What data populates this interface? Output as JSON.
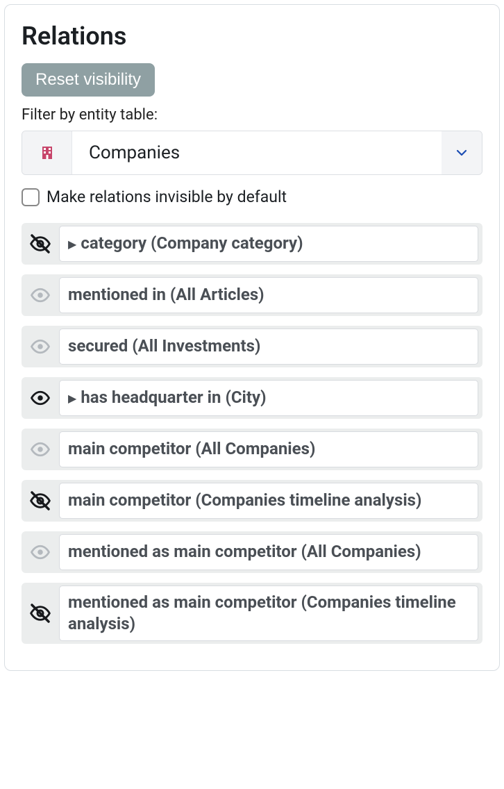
{
  "title": "Relations",
  "reset_button": "Reset visibility",
  "filter_label": "Filter by entity table:",
  "dropdown": {
    "selected": "Companies"
  },
  "checkbox_label": "Make relations invisible by default",
  "relations": [
    {
      "label": "category (Company category)",
      "state": "hidden",
      "expandable": true
    },
    {
      "label": "mentioned in (All Articles)",
      "state": "dim",
      "expandable": false
    },
    {
      "label": "secured (All Investments)",
      "state": "dim",
      "expandable": false
    },
    {
      "label": "has headquarter in (City)",
      "state": "visible",
      "expandable": true
    },
    {
      "label": "main competitor (All Companies)",
      "state": "dim",
      "expandable": false
    },
    {
      "label": "main competitor (Companies timeline analysis)",
      "state": "hidden",
      "expandable": false
    },
    {
      "label": "mentioned as main competitor (All Companies)",
      "state": "dim",
      "expandable": false
    },
    {
      "label": "mentioned as main competitor (Companies timeline analysis)",
      "state": "hidden",
      "expandable": false
    }
  ]
}
